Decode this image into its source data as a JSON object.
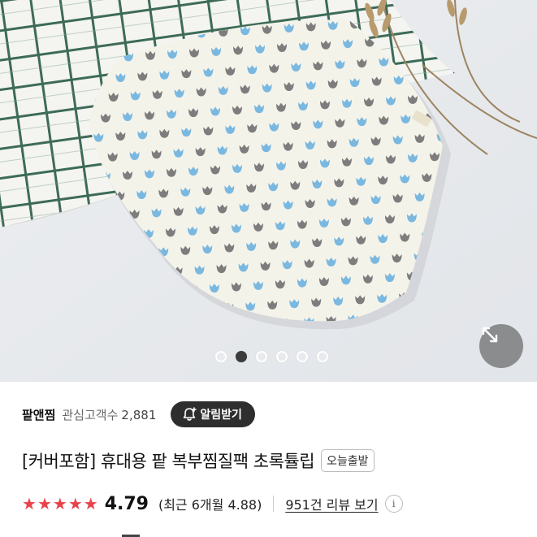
{
  "gallery": {
    "page_count": 6,
    "active_index": 1
  },
  "store": {
    "name": "팥앤찜",
    "followers_label": "관심고객수",
    "followers_count": "2,881",
    "alarm_button": "알림받기"
  },
  "product": {
    "title": "[커버포함] 휴대용 팥 복부찜질팩 초록튤립",
    "badge": "오늘출발"
  },
  "rating": {
    "stars": 5,
    "score": "4.79",
    "recent": "(최근 6개월 4.88)",
    "reviews_link": "951건 리뷰 보기",
    "info_glyph": "i"
  },
  "colors": {
    "star": "#e8424b",
    "alarm_bg": "#2e2e2e",
    "tulip_blue": "#7ab8e0",
    "tulip_gray": "#7d7d7d",
    "check_green": "#3d6b57"
  },
  "icons": {
    "expand": "expand-arrows-icon",
    "bell": "bell-plus-icon",
    "info": "info-icon",
    "star": "star-icon"
  }
}
